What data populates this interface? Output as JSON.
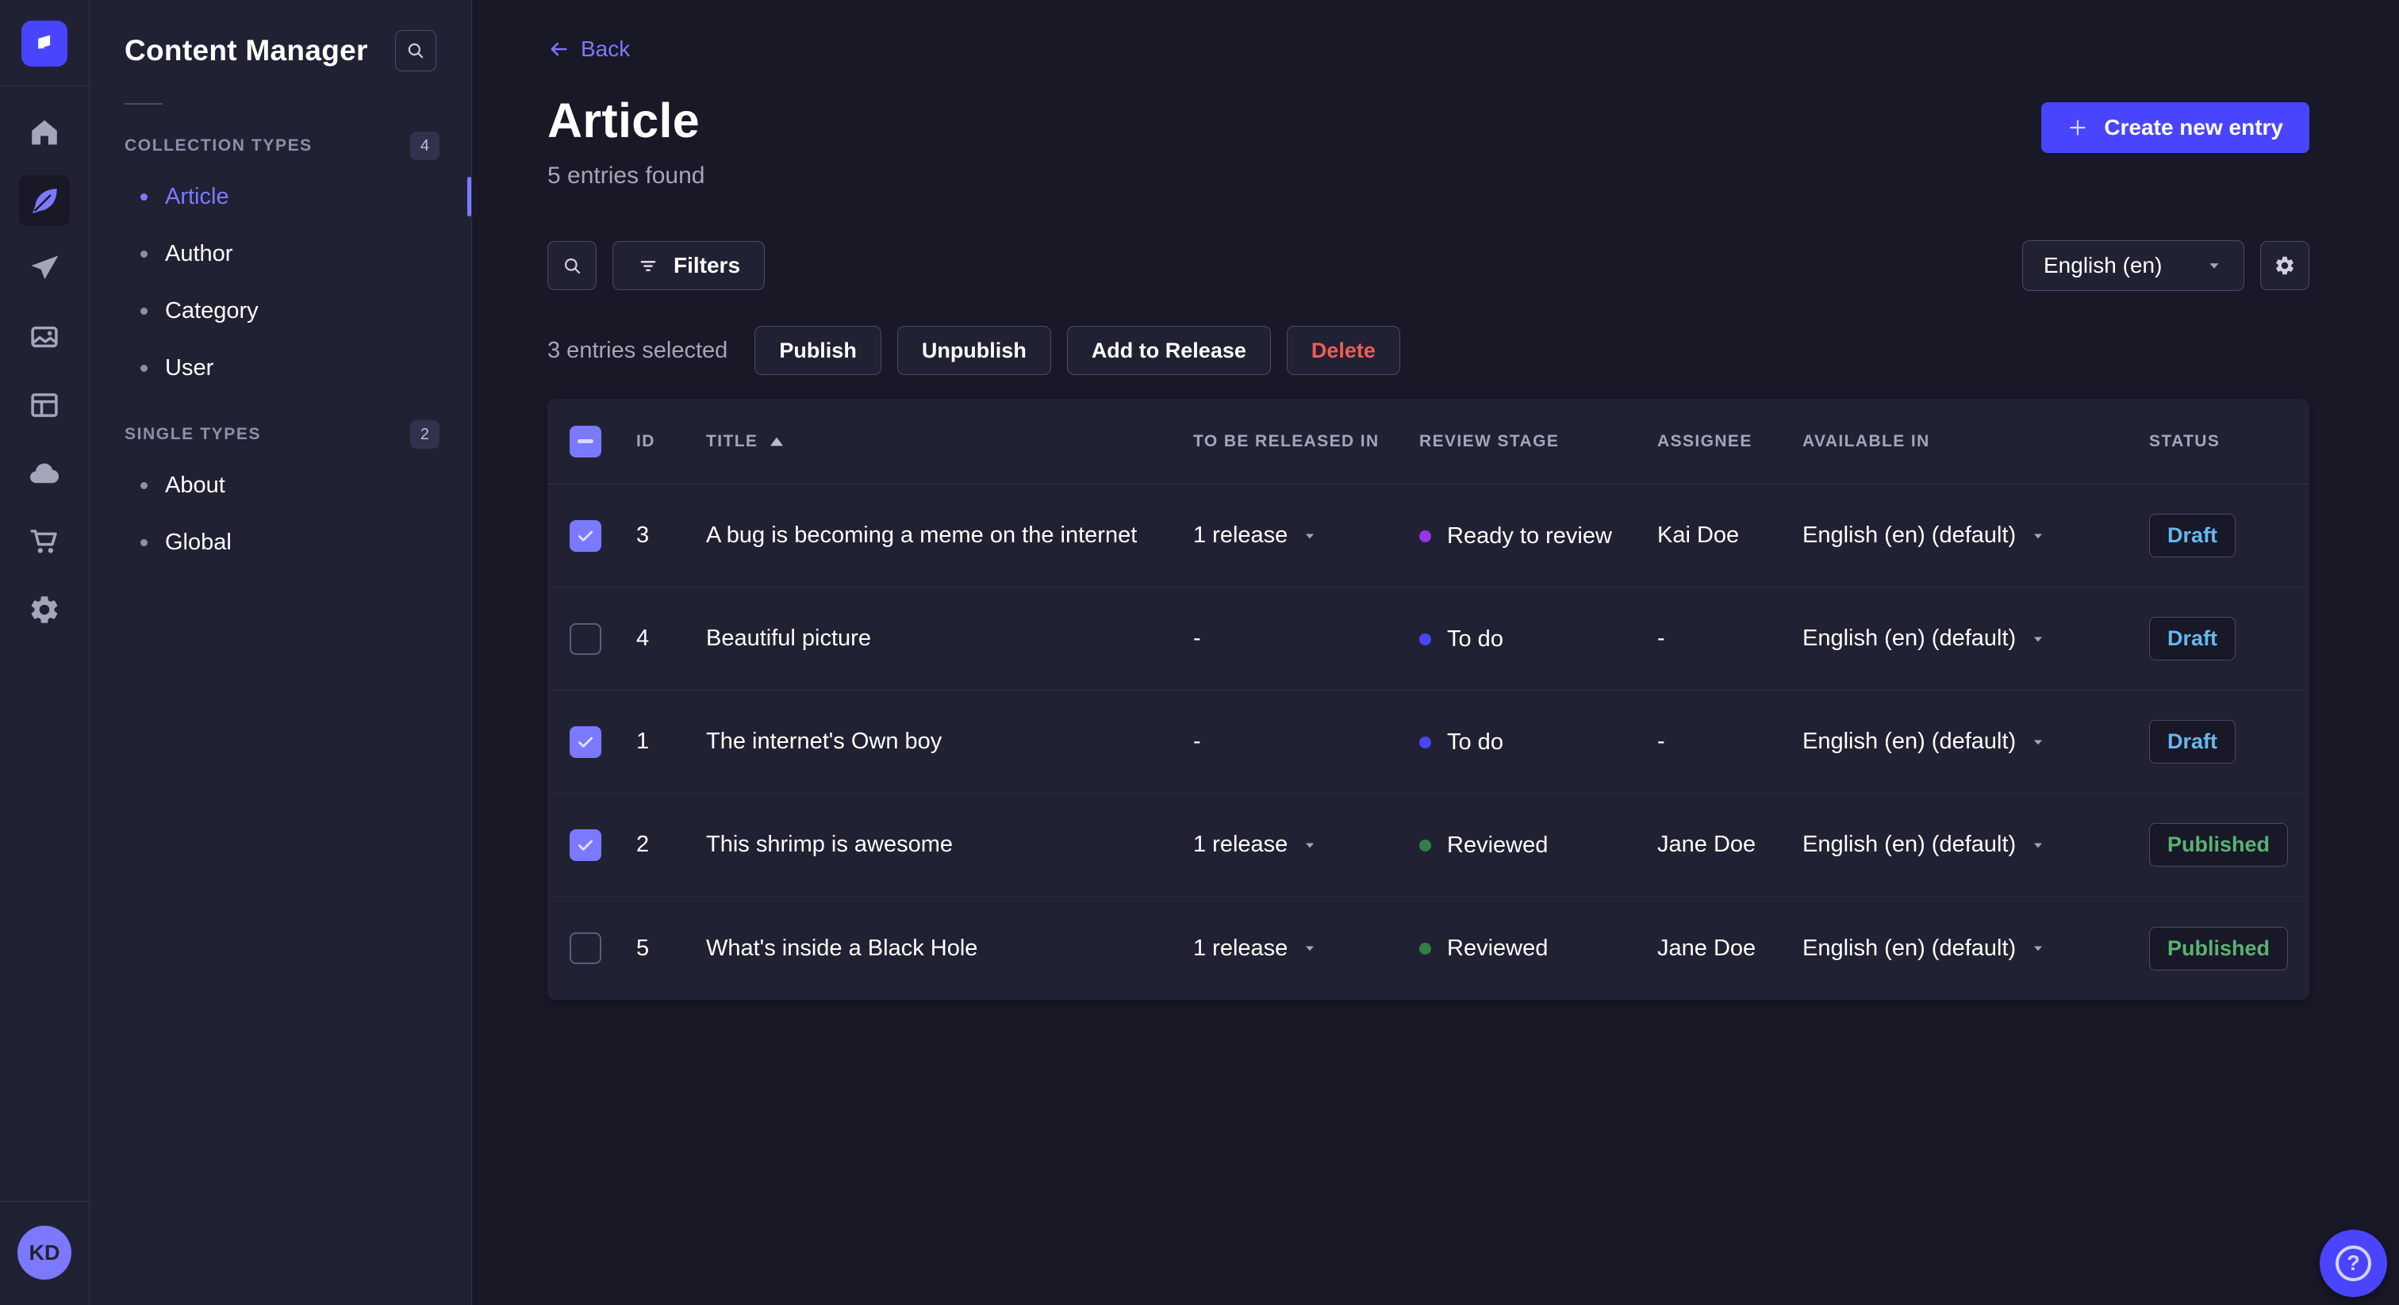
{
  "colors": {
    "accent": "#4945ff",
    "accent_light": "#7b79ff",
    "danger": "#ee5e52",
    "draft": "#66b7f1",
    "published": "#5cb176",
    "stage_todo": "#4945ff",
    "stage_ready_to_review": "#9736e8",
    "stage_reviewed": "#328048"
  },
  "rail": {
    "items": [
      "home",
      "content-manager",
      "releases",
      "media-library",
      "content-type-builder",
      "deploy",
      "marketplace",
      "settings"
    ],
    "active_item": "content-manager",
    "avatar_initials": "KD"
  },
  "subnav": {
    "title": "Content Manager",
    "sections": [
      {
        "label": "COLLECTION TYPES",
        "count": "4",
        "items": [
          {
            "label": "Article",
            "active": true
          },
          {
            "label": "Author",
            "active": false
          },
          {
            "label": "Category",
            "active": false
          },
          {
            "label": "User",
            "active": false
          }
        ]
      },
      {
        "label": "SINGLE TYPES",
        "count": "2",
        "items": [
          {
            "label": "About",
            "active": false
          },
          {
            "label": "Global",
            "active": false
          }
        ]
      }
    ]
  },
  "header": {
    "back_label": "Back",
    "title": "Article",
    "subtitle": "5 entries found",
    "create_label": "Create new entry"
  },
  "toolbar": {
    "filters_label": "Filters",
    "locale_value": "English (en)"
  },
  "selection": {
    "text": "3 entries selected",
    "publish_label": "Publish",
    "unpublish_label": "Unpublish",
    "add_to_release_label": "Add to Release",
    "delete_label": "Delete"
  },
  "table": {
    "select_all_state": "indeterminate",
    "sort": {
      "column": "TITLE",
      "direction": "asc"
    },
    "columns": [
      "ID",
      "TITLE",
      "TO BE RELEASED IN",
      "REVIEW STAGE",
      "ASSIGNEE",
      "AVAILABLE IN",
      "STATUS"
    ],
    "rows": [
      {
        "checked": true,
        "id": "3",
        "title": "A bug is becoming a meme on the internet",
        "release": "1 release",
        "stage": "Ready to review",
        "stage_color": "#9736e8",
        "assignee": "Kai Doe",
        "locale": "English (en) (default)",
        "status": "Draft",
        "status_color": "#66b7f1"
      },
      {
        "checked": false,
        "id": "4",
        "title": "Beautiful picture",
        "release": "-",
        "stage": "To do",
        "stage_color": "#4945ff",
        "assignee": "-",
        "locale": "English (en) (default)",
        "status": "Draft",
        "status_color": "#66b7f1"
      },
      {
        "checked": true,
        "id": "1",
        "title": "The internet's Own boy",
        "release": "-",
        "stage": "To do",
        "stage_color": "#4945ff",
        "assignee": "-",
        "locale": "English (en) (default)",
        "status": "Draft",
        "status_color": "#66b7f1"
      },
      {
        "checked": true,
        "id": "2",
        "title": "This shrimp is awesome",
        "release": "1 release",
        "stage": "Reviewed",
        "stage_color": "#328048",
        "assignee": "Jane Doe",
        "locale": "English (en) (default)",
        "status": "Published",
        "status_color": "#5cb176"
      },
      {
        "checked": false,
        "id": "5",
        "title": "What's inside a Black Hole",
        "release": "1 release",
        "stage": "Reviewed",
        "stage_color": "#328048",
        "assignee": "Jane Doe",
        "locale": "English (en) (default)",
        "status": "Published",
        "status_color": "#5cb176"
      }
    ]
  },
  "help": {
    "icon_glyph": "?"
  }
}
